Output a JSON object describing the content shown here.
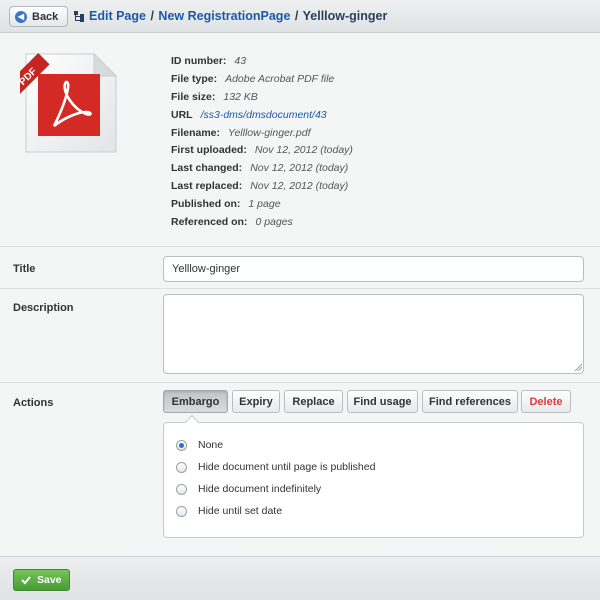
{
  "header": {
    "back_label": "Back",
    "breadcrumbs": [
      {
        "label": "Edit Page"
      },
      {
        "label": "New RegistrationPage"
      },
      {
        "label": "Yelllow-ginger"
      }
    ],
    "separator": "/"
  },
  "file_icon": {
    "badge": "PDF"
  },
  "meta": [
    {
      "label": "ID number:",
      "value": "43"
    },
    {
      "label": "File type:",
      "value": "Adobe Acrobat PDF file"
    },
    {
      "label": "File size:",
      "value": "132 KB"
    },
    {
      "label": "URL",
      "value": "/ss3-dms/dmsdocument/43"
    },
    {
      "label": "Filename:",
      "value": "Yelllow-ginger.pdf"
    },
    {
      "label": "First uploaded:",
      "value": "Nov 12, 2012 (today)"
    },
    {
      "label": "Last changed:",
      "value": "Nov 12, 2012 (today)"
    },
    {
      "label": "Last replaced:",
      "value": "Nov 12, 2012 (today)"
    },
    {
      "label": "Published on:",
      "value": "1 page"
    },
    {
      "label": "Referenced on:",
      "value": "0 pages"
    }
  ],
  "form": {
    "title_label": "Title",
    "title_value": "Yelllow-ginger",
    "description_label": "Description",
    "description_value": "",
    "actions_label": "Actions"
  },
  "actions": [
    {
      "label": "Embargo"
    },
    {
      "label": "Expiry"
    },
    {
      "label": "Replace"
    },
    {
      "label": "Find usage"
    },
    {
      "label": "Find references"
    },
    {
      "label": "Delete"
    }
  ],
  "embargo_options": [
    {
      "label": "None",
      "checked": true
    },
    {
      "label": "Hide document until page is published",
      "checked": false
    },
    {
      "label": "Hide document indefinitely",
      "checked": false
    },
    {
      "label": "Hide until set date",
      "checked": false
    }
  ],
  "footer": {
    "save_label": "Save"
  },
  "colors": {
    "accent": "#1c58a8",
    "save": "#4a9a35",
    "delete": "#e03a3a",
    "pdf_red": "#d42a26"
  }
}
